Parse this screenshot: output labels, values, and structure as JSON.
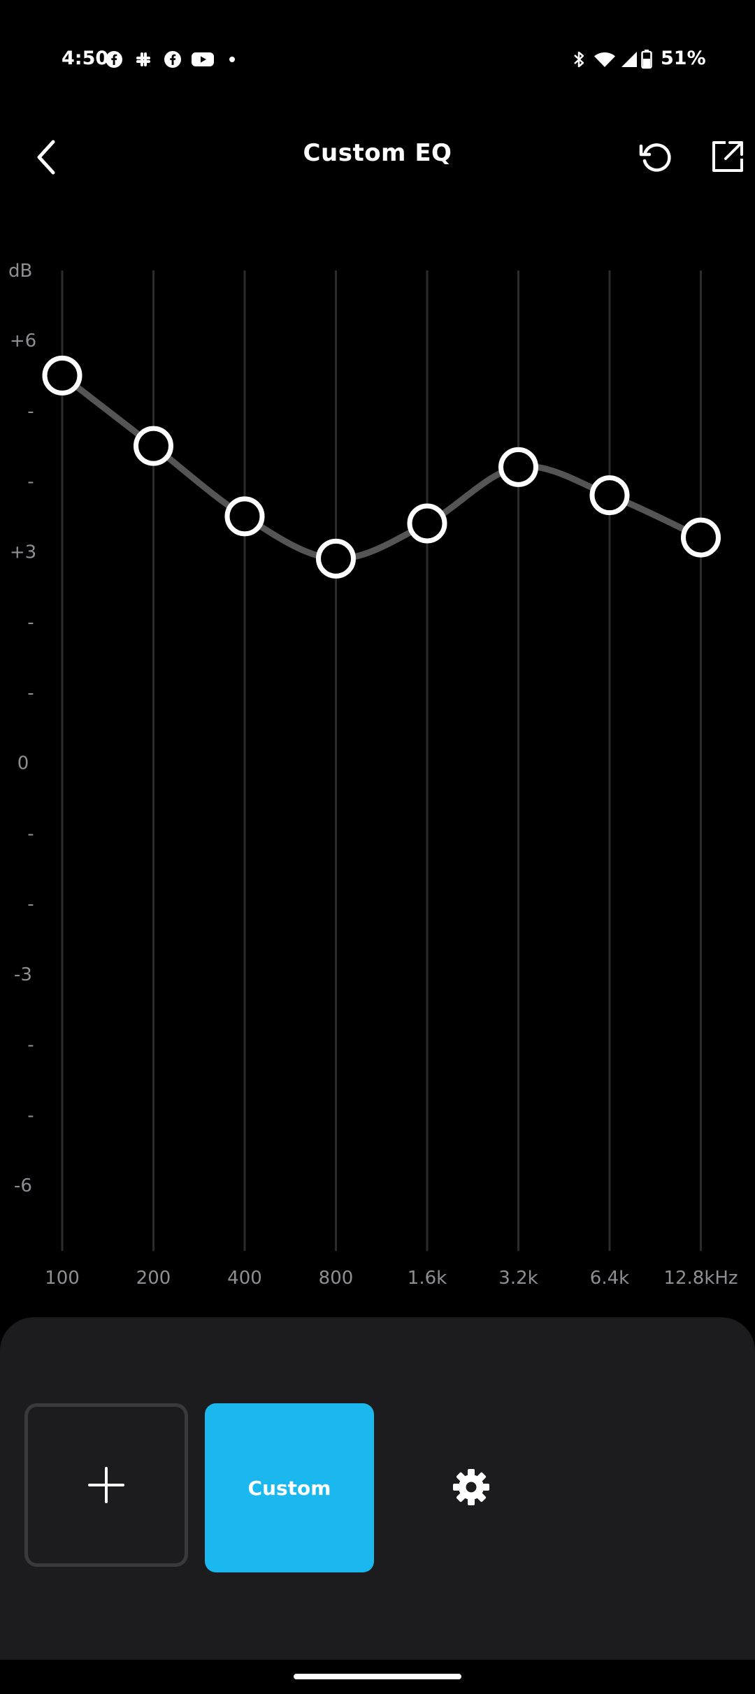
{
  "status_bar": {
    "time": "4:50",
    "battery_percent": "51%",
    "left_icons": [
      "facebook-icon",
      "slack-icon",
      "facebook-icon",
      "youtube-icon",
      "dot-icon"
    ],
    "right_icons": [
      "bluetooth-icon",
      "wifi-icon",
      "signal-icon",
      "battery-icon"
    ]
  },
  "header": {
    "title": "Custom EQ",
    "back_icon": "chevron-left-icon",
    "reset_icon": "reset-icon",
    "share_icon": "share-icon"
  },
  "chart_data": {
    "type": "line",
    "ylabel": "dB",
    "y_tick_labels": [
      "+6",
      "-",
      "-",
      "+3",
      "-",
      "-",
      "0",
      "-",
      "-",
      "-3",
      "-",
      "-",
      "-6"
    ],
    "ylim": [
      -6,
      6
    ],
    "categories": [
      "100",
      "200",
      "400",
      "800",
      "1.6k",
      "3.2k",
      "6.4k",
      "12.8kHz"
    ],
    "series": [
      {
        "values": [
          5.5,
          4.5,
          3.5,
          2.9,
          3.4,
          4.2,
          3.8,
          3.2
        ]
      }
    ],
    "line_color": "#555555",
    "handle_color": "#ffffff"
  },
  "bottom_panel": {
    "add_icon": "plus-icon",
    "preset_label": "Custom",
    "preset_color": "#1ab8ef",
    "settings_icon": "gear-icon"
  }
}
